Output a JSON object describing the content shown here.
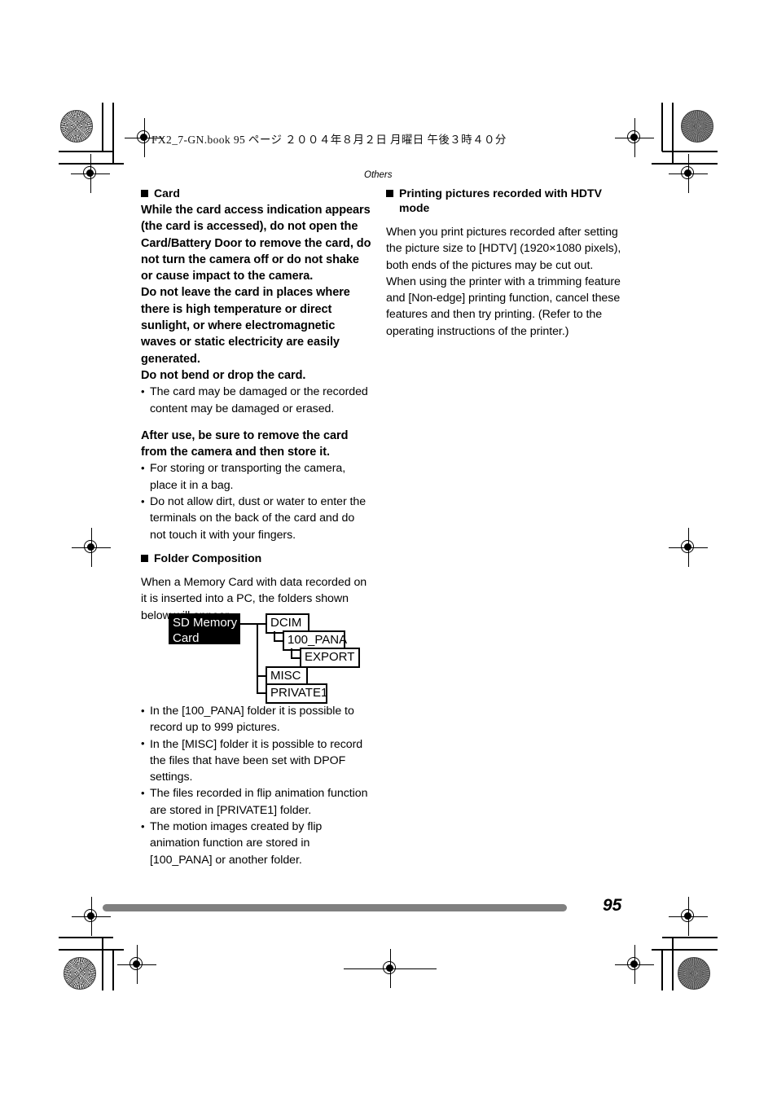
{
  "print_header": "FX2_7-GN.book  95 ページ  ２００４年８月２日  月曜日  午後３時４０分",
  "running_head": "Others",
  "page_number": "95",
  "left_column": {
    "card_section": {
      "heading": "Card",
      "bold_paragraphs": [
        "While the card access indication appears (the card is accessed), do not open the Card/Battery Door to remove the card, do not turn the camera off or do not shake or cause impact to the camera.",
        "Do not leave the card in places where there is high temperature or direct sunlight, or where electromagnetic waves or static electricity are easily generated.",
        "Do not bend or drop the card."
      ],
      "bullets_1": [
        "The card may be damaged or the recorded content may be damaged or erased."
      ],
      "bold_paragraph_2": "After use, be sure to remove the card from the camera and then store it.",
      "bullets_2": [
        "For storing or transporting the camera, place it in a bag.",
        "Do not allow dirt, dust or water to enter the terminals on the back of the card and do not touch it with your fingers."
      ]
    },
    "folder_section": {
      "heading": "Folder Composition",
      "intro": "When a Memory Card with data recorded on it is inserted into a PC, the folders shown below will appear.",
      "diagram": {
        "root": "SD Memory Card",
        "nodes": [
          "DCIM",
          "100_PANA",
          "EXPORT",
          "MISC",
          "PRIVATE1"
        ]
      },
      "bullets": [
        "In the [100_PANA] folder it is possible to record up to 999 pictures.",
        "In the [MISC] folder it is possible to record the files that have been set with DPOF settings.",
        "The files recorded in flip animation function are stored in [PRIVATE1] folder.",
        "The motion images created by flip animation function are stored in [100_PANA] or another folder."
      ]
    }
  },
  "right_column": {
    "hdtv_section": {
      "heading": "Printing pictures recorded with HDTV mode",
      "paragraphs": [
        "When you print pictures recorded after setting the picture size to [HDTV] (1920×1080 pixels), both ends of the pictures may be cut out.",
        "When using the printer with a trimming feature and [Non-edge] printing function, cancel these features and then try printing. (Refer to the operating instructions of the printer.)"
      ]
    }
  }
}
